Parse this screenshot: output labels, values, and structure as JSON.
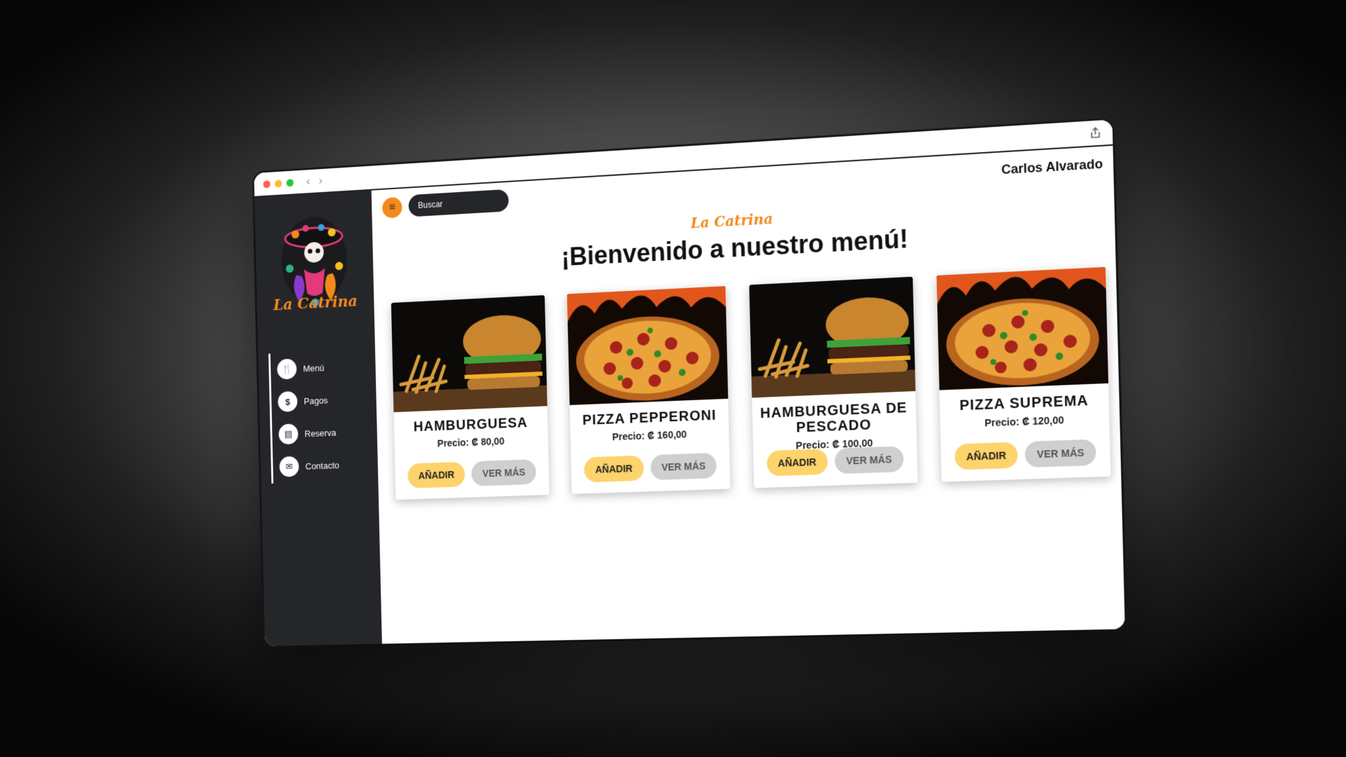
{
  "sidebar": {
    "logo_text": "La Catrina",
    "items": [
      {
        "label": "Menú",
        "icon": "utensils-icon",
        "glyph": "🍴"
      },
      {
        "label": "Pagos",
        "icon": "dollar-icon",
        "glyph": "$"
      },
      {
        "label": "Reserva",
        "icon": "calendar-icon",
        "glyph": "▤"
      },
      {
        "label": "Contacto",
        "icon": "mail-icon",
        "glyph": "✉"
      }
    ]
  },
  "header": {
    "search_placeholder": "Buscar",
    "user_name": "Carlos Alvarado",
    "menu_glyph": "≡"
  },
  "main": {
    "brand": "La Catrina",
    "headline": "¡Bienvenido a nuestro menú!",
    "products": [
      {
        "name": "HAMBURGUESA",
        "price": "Precio: ₡ 80,00",
        "image": "burger-image",
        "add_label": "AÑADIR",
        "more_label": "VER MÁS"
      },
      {
        "name": "PIZZA PEPPERONI",
        "price": "Precio: ₡ 160,00",
        "image": "pizza-image",
        "add_label": "AÑADIR",
        "more_label": "VER MÁS"
      },
      {
        "name": "HAMBURGUESA DE PESCADO",
        "price": "Precio: ₡ 100,00",
        "image": "burger-image",
        "add_label": "AÑADIR",
        "more_label": "VER MÁS"
      },
      {
        "name": "PIZZA SUPREMA",
        "price": "Precio: ₡ 120,00",
        "image": "pizza-image",
        "add_label": "AÑADIR",
        "more_label": "VER MÁS"
      }
    ]
  },
  "colors": {
    "accent": "#f28a1c",
    "sidebar_bg": "#25262a",
    "add_button": "#fdd36b",
    "more_button": "#cfcfcf"
  }
}
